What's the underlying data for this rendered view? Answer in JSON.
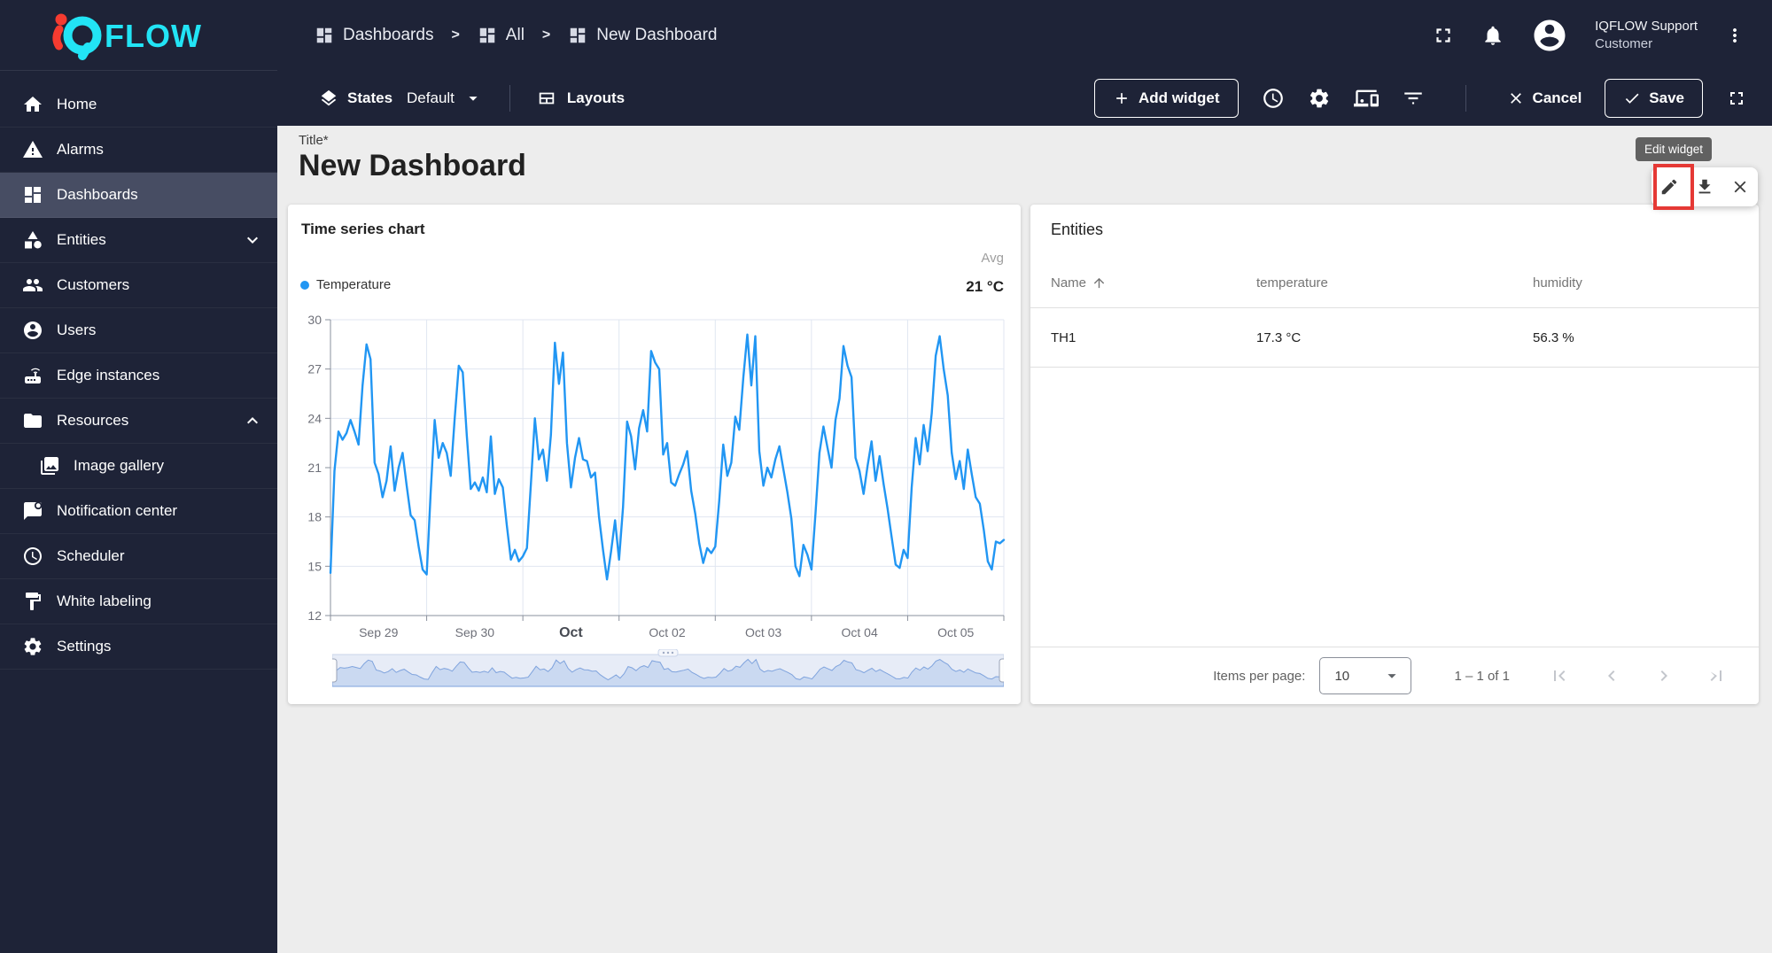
{
  "brand": {
    "logo_text": "FLOW"
  },
  "header": {
    "breadcrumbs": [
      {
        "label": "Dashboards"
      },
      {
        "label": "All"
      },
      {
        "label": "New Dashboard"
      }
    ],
    "user": {
      "name": "IQFLOW Support",
      "role": "Customer"
    }
  },
  "toolbar": {
    "states_label": "States",
    "states_value": "Default",
    "layouts_label": "Layouts",
    "add_widget_label": "Add widget",
    "cancel_label": "Cancel",
    "save_label": "Save"
  },
  "sidebar": {
    "items": [
      {
        "icon": "home",
        "label": "Home"
      },
      {
        "icon": "warning",
        "label": "Alarms"
      },
      {
        "icon": "dashboards",
        "label": "Dashboards",
        "active": true
      },
      {
        "icon": "category",
        "label": "Entities",
        "chevron": "down"
      },
      {
        "icon": "group",
        "label": "Customers"
      },
      {
        "icon": "account",
        "label": "Users"
      },
      {
        "icon": "router",
        "label": "Edge instances"
      },
      {
        "icon": "folder",
        "label": "Resources",
        "chevron": "up"
      },
      {
        "icon": "image",
        "label": "Image gallery",
        "indent": true
      },
      {
        "icon": "notification",
        "label": "Notification center"
      },
      {
        "icon": "schedule",
        "label": "Scheduler"
      },
      {
        "icon": "paint",
        "label": "White labeling"
      },
      {
        "icon": "settings",
        "label": "Settings"
      }
    ]
  },
  "content": {
    "title_label": "Title*",
    "dashboard_title": "New Dashboard",
    "edit_tooltip": "Edit widget"
  },
  "widgets": {
    "timeseries": {
      "title": "Time series chart",
      "legend_series": "Temperature",
      "agg_label": "Avg",
      "agg_value": "21 °C"
    },
    "entities": {
      "title": "Entities",
      "columns": [
        "Name",
        "temperature",
        "humidity"
      ],
      "rows": [
        [
          "TH1",
          "17.3 °C",
          "56.3 %"
        ]
      ],
      "items_per_page_label": "Items per page:",
      "items_per_page_value": "10",
      "range_label": "1 – 1 of 1"
    }
  },
  "chart_data": {
    "type": "line",
    "title": "Time series chart",
    "ylim": [
      12,
      30
    ],
    "yticks": [
      12,
      15,
      18,
      21,
      24,
      27,
      30
    ],
    "xticklabels": [
      "Sep 29",
      "Sep 30",
      "Oct",
      "Oct 02",
      "Oct 03",
      "Oct 04",
      "Oct 05"
    ],
    "bold_xtick_index": 2,
    "grid": true,
    "legend_position": "top-left",
    "avg_label": "Avg",
    "avg_value": "21 °C",
    "unit": "°C",
    "series": [
      {
        "name": "Temperature",
        "color": "#2196f3",
        "values": [
          14.6,
          20.8,
          23.2,
          22.7,
          23.1,
          23.9,
          23.2,
          22.4,
          26.0,
          28.5,
          27.6,
          21.3,
          20.6,
          19.2,
          20.2,
          22.3,
          19.6,
          21.0,
          21.9,
          19.9,
          18.1,
          17.8,
          16.2,
          14.8,
          14.5,
          19.5,
          23.9,
          21.6,
          22.5,
          21.9,
          20.5,
          24.0,
          27.2,
          26.8,
          23.0,
          19.7,
          20.1,
          19.6,
          20.4,
          19.5,
          22.9,
          19.4,
          20.3,
          19.8,
          17.5,
          15.4,
          16.0,
          15.3,
          15.6,
          16.1,
          20.0,
          24.0,
          21.5,
          22.1,
          20.2,
          23.0,
          28.6,
          26.1,
          28.0,
          22.5,
          19.8,
          21.6,
          22.8,
          21.5,
          21.4,
          20.4,
          20.7,
          18.0,
          16.0,
          14.2,
          15.9,
          17.8,
          15.4,
          18.6,
          23.8,
          22.9,
          20.9,
          23.4,
          24.5,
          23.2,
          28.1,
          27.4,
          27.0,
          21.8,
          22.5,
          20.1,
          19.9,
          20.6,
          21.2,
          22.0,
          19.6,
          18.2,
          16.4,
          15.2,
          16.1,
          15.8,
          16.2,
          19.0,
          22.4,
          20.5,
          21.3,
          24.1,
          23.3,
          26.5,
          29.1,
          26.0,
          29.0,
          22.0,
          19.9,
          21.0,
          20.4,
          21.5,
          22.3,
          20.9,
          19.5,
          17.9,
          15.0,
          14.4,
          16.3,
          15.7,
          14.8,
          18.2,
          21.9,
          23.5,
          22.2,
          21.0,
          23.9,
          25.2,
          28.4,
          27.2,
          26.5,
          21.6,
          20.8,
          19.4,
          21.1,
          22.6,
          20.2,
          21.7,
          20.0,
          18.5,
          16.8,
          15.1,
          14.9,
          16.0,
          15.5,
          19.8,
          22.8,
          21.2,
          23.6,
          22.0,
          24.3,
          27.8,
          29.0,
          27.0,
          25.4,
          21.9,
          20.3,
          21.4,
          19.7,
          22.1,
          20.6,
          19.2,
          18.8,
          17.2,
          15.3,
          14.8,
          16.5,
          16.4,
          16.6
        ]
      }
    ]
  },
  "colors": {
    "header_bg": "#1e2337",
    "sidebar_active": "#474d63",
    "accent_cyan": "#22e4f5",
    "logo_red": "#f63b30",
    "chart_line": "#2196f3",
    "highlight_red": "#e53935",
    "tooltip_bg": "#616161",
    "content_bg": "#ededed"
  }
}
